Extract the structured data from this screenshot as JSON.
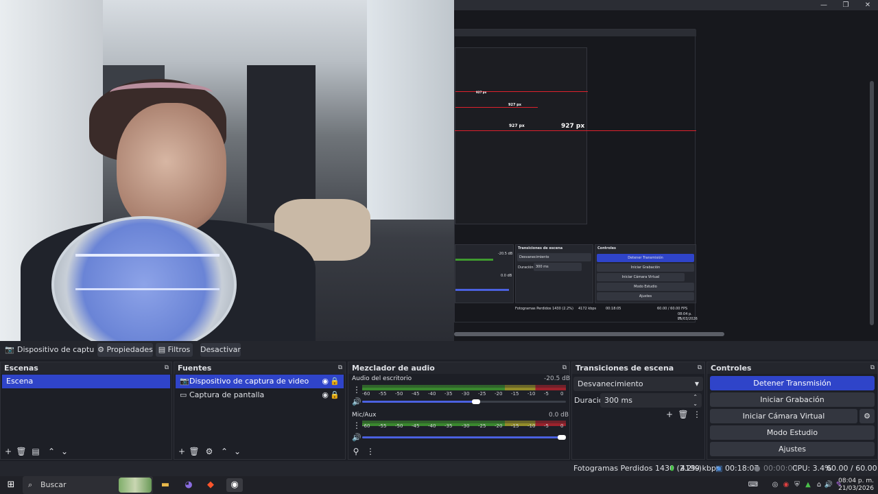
{
  "window_controls": {
    "minimize": "—",
    "restore": "❐",
    "close": "✕"
  },
  "preview": {
    "nested_label_large": "927 px",
    "nested_label_small": "927 px",
    "nested_label_tiny": "927 px",
    "nested_transitions_title": "Transiciones de escena",
    "nested_controls_title": "Controles",
    "nested_fade": "Desvanecimiento",
    "nested_duration_label": "Duración",
    "nested_duration_value": "300 ms",
    "nested_meter1_db": "-20.5 dB",
    "nested_meter2_db": "0.0 dB",
    "nested_btn_stop": "Detener Transmisión",
    "nested_btn_record": "Iniciar Grabación",
    "nested_btn_vcam": "Iniciar Cámara Virtual",
    "nested_btn_studio": "Modo Estudio",
    "nested_btn_settings": "Ajustes",
    "nested_status": "Fotogramas Perdidos 1430 (2.2%)",
    "nested_kbps": "4172 kbps",
    "nested_time": "00:18:05",
    "nested_fps": "60.00 / 60.00 FPS",
    "nested_clock_time": "08:04 p. m.",
    "nested_clock_date": "21/03/2026"
  },
  "source_toolbar": {
    "source_name": "Dispositivo de captura de v",
    "properties": "Propiedades",
    "filters": "Filtros",
    "deactivate": "Desactivar"
  },
  "scenes": {
    "title": "Escenas",
    "items": [
      "Escena"
    ]
  },
  "sources": {
    "title": "Fuentes",
    "items": [
      "Dispositivo de captura de video",
      "Captura de pantalla"
    ]
  },
  "audio": {
    "title": "Mezclador de audio",
    "channels": [
      {
        "name": "Audio del escritorio",
        "db": "-20.5 dB",
        "volume_fraction": 0.56
      },
      {
        "name": "Mic/Aux",
        "db": "0.0 dB",
        "volume_fraction": 1.0
      }
    ],
    "ticks": [
      "-60",
      "-55",
      "-50",
      "-45",
      "-40",
      "-35",
      "-30",
      "-25",
      "-20",
      "-15",
      "-10",
      "-5",
      "0"
    ]
  },
  "transitions": {
    "title": "Transiciones de escena",
    "type": "Desvanecimiento",
    "duration_label": "Duración",
    "duration_value": "300 ms"
  },
  "controls": {
    "title": "Controles",
    "stop_stream": "Detener Transmisión",
    "start_recording": "Iniciar Grabación",
    "start_vcam": "Iniciar Cámara Virtual",
    "studio_mode": "Modo Estudio",
    "settings": "Ajustes"
  },
  "status": {
    "dropped_frames": "Fotogramas Perdidos 1430 (2.2%)",
    "bitrate": "4199 kbps",
    "stream_time": "00:18:07",
    "record_time": "00:00:00",
    "cpu": "CPU: 3.4%",
    "fps": "60.00 / 60.00 FPS"
  },
  "taskbar": {
    "search": "Buscar",
    "time": "08:04 p. m.",
    "date": "21/03/2026"
  },
  "colors": {
    "accent": "#2f44c9",
    "meter_green": "#3f9a2f",
    "meter_yellow": "#a8a02a",
    "meter_red": "#b3232d",
    "guide_red": "#e0212d"
  }
}
